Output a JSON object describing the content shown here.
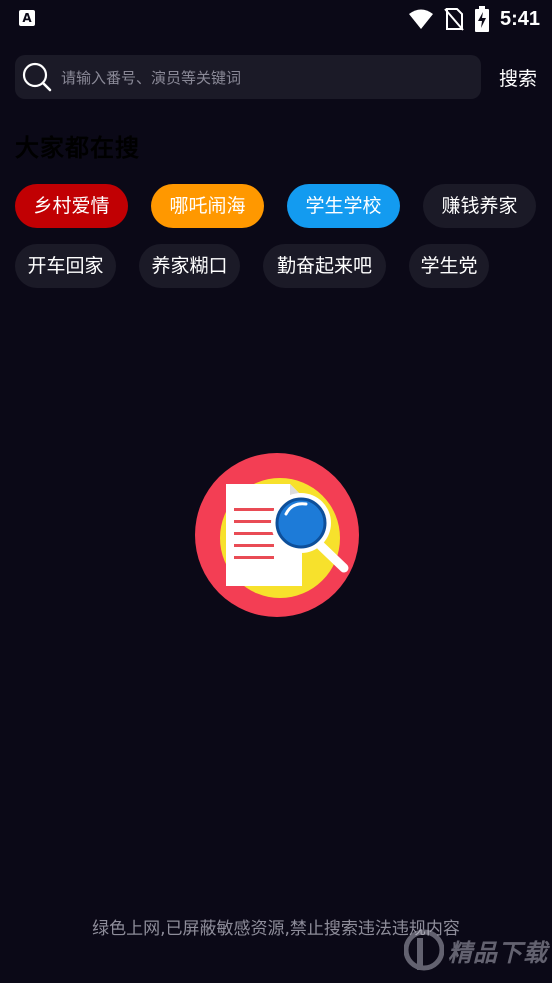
{
  "status_bar": {
    "app_icon_letter": "A",
    "time": "5:41",
    "icons": [
      "wifi-icon",
      "no-sim-icon",
      "battery-charging-icon"
    ]
  },
  "search": {
    "placeholder": "请输入番号、演员等关键词",
    "button_label": "搜索"
  },
  "hot_section": {
    "title": "大家都在搜",
    "tags": [
      {
        "label": "乡村爱情",
        "color": "#c10003"
      },
      {
        "label": "哪吒闹海",
        "color": "#ff9800"
      },
      {
        "label": "学生学校",
        "color": "#139bf0"
      },
      {
        "label": "赚钱养家",
        "color": "#1b1a27"
      },
      {
        "label": "开车回家",
        "color": "#1b1a27"
      },
      {
        "label": "养家糊口",
        "color": "#1b1a27"
      },
      {
        "label": "勤奋起来吧",
        "color": "#1b1a27"
      },
      {
        "label": "学生党",
        "color": "#1b1a27"
      }
    ]
  },
  "illustration": {
    "icon": "search-document-icon",
    "colors": {
      "circle": "#f33e54",
      "inner": "#f7e12c",
      "paper": "#ffffff",
      "lines": "#e94b55",
      "lens": "#1d7bd8"
    }
  },
  "footer": {
    "notice": "绿色上网,已屏蔽敏感资源,禁止搜索违法违规内容"
  },
  "watermark": {
    "text": "精品下载"
  }
}
